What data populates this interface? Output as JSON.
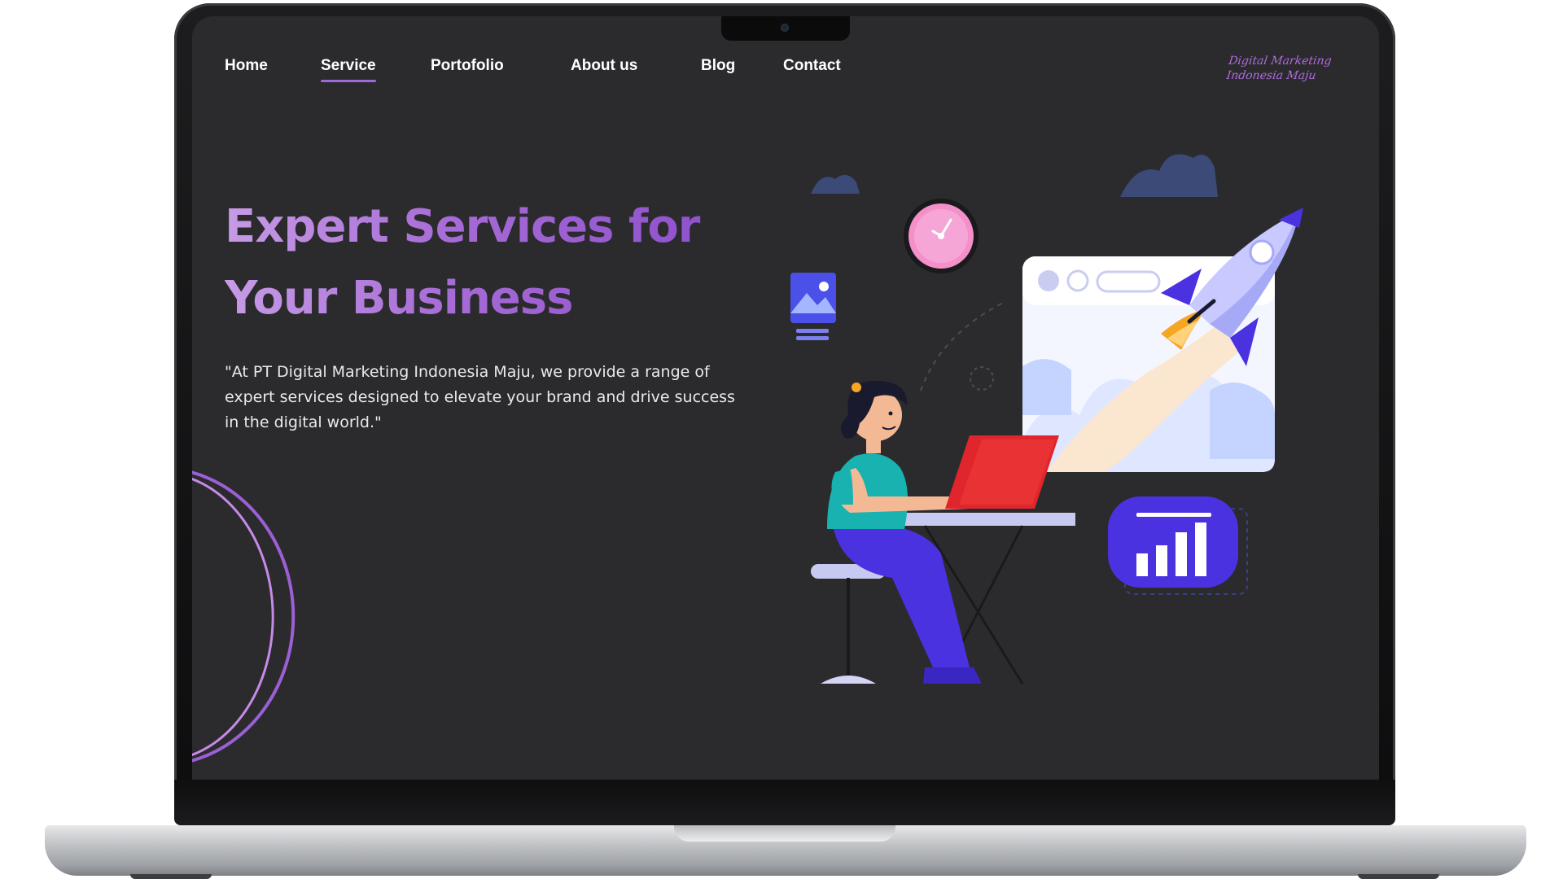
{
  "nav": {
    "items": [
      {
        "label": "Home"
      },
      {
        "label": "Service"
      },
      {
        "label": "Portofolio"
      },
      {
        "label": "About us"
      },
      {
        "label": "Blog"
      },
      {
        "label": "Contact"
      }
    ],
    "active": "Service"
  },
  "logo": {
    "line1": "Digital Marketing",
    "line2": "Indonesia Maju"
  },
  "hero": {
    "title_line1": "Expert Services for",
    "title_line2": "Your Business",
    "description": "\"At PT Digital Marketing Indonesia Maju, we provide a range of expert services designed to elevate your brand and drive success in the digital world.\""
  },
  "colors": {
    "accent": "#9b6bd9",
    "screen_bg": "#2b2b2d",
    "illustration_blue": "#4a32e0",
    "clock_pink": "#f48fc9",
    "laptop_red": "#e0262c"
  },
  "icons": [
    "clock-icon",
    "image-icon",
    "rocket-icon",
    "bar-chart-icon",
    "cloud-icon"
  ]
}
